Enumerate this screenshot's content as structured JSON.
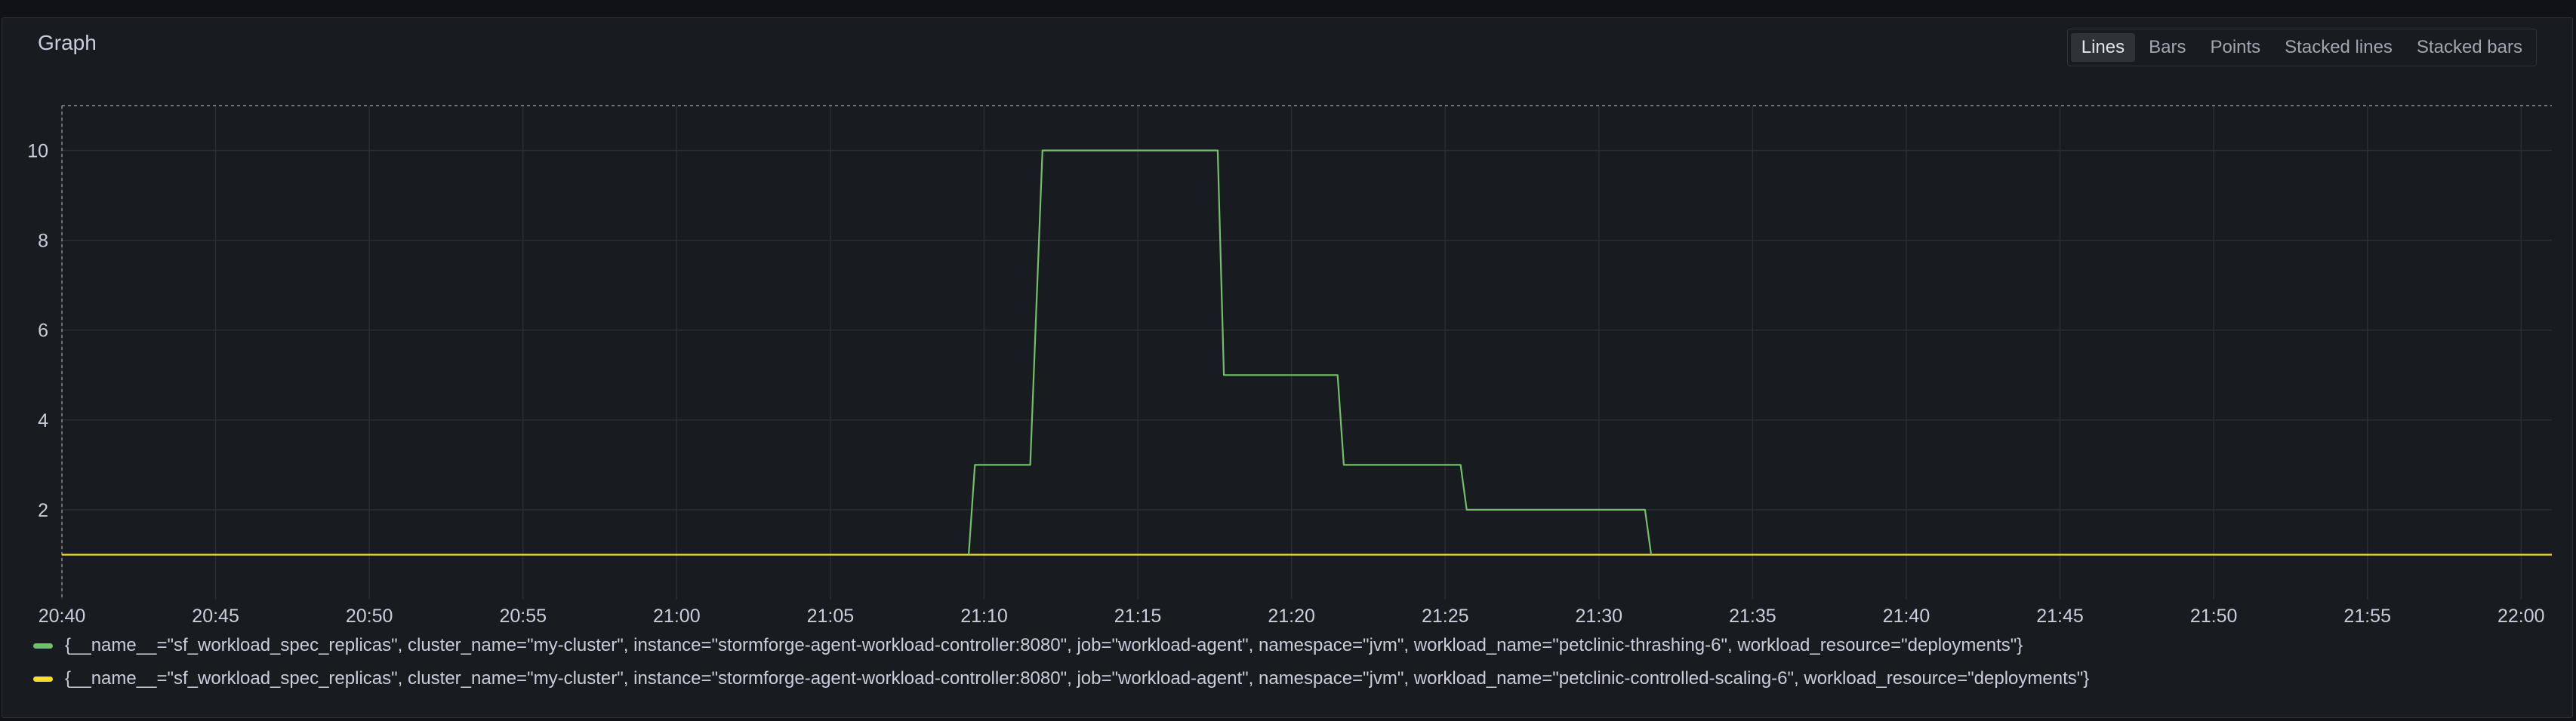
{
  "panel": {
    "title": "Graph"
  },
  "viz_options": [
    {
      "label": "Lines",
      "active": true
    },
    {
      "label": "Bars",
      "active": false
    },
    {
      "label": "Points",
      "active": false
    },
    {
      "label": "Stacked lines",
      "active": false
    },
    {
      "label": "Stacked bars",
      "active": false
    }
  ],
  "chart_data": {
    "type": "line",
    "x_ticks": [
      "20:40",
      "20:45",
      "20:50",
      "20:55",
      "21:00",
      "21:05",
      "21:10",
      "21:15",
      "21:20",
      "21:25",
      "21:30",
      "21:35",
      "21:40",
      "21:45",
      "21:50",
      "21:55",
      "22:00"
    ],
    "y_ticks": [
      2,
      4,
      6,
      8,
      10
    ],
    "xlim": [
      "20:40",
      "22:01"
    ],
    "ylim": [
      0.0,
      11.0
    ],
    "grid": true,
    "legend_position": "bottom",
    "series": [
      {
        "name": "{__name__=\"sf_workload_spec_replicas\", cluster_name=\"my-cluster\", instance=\"stormforge-agent-workload-controller:8080\", job=\"workload-agent\", namespace=\"jvm\", workload_name=\"petclinic-thrashing-6\", workload_resource=\"deployments\"}",
        "color": "#73bf69",
        "points": [
          [
            "21:09.5",
            1
          ],
          [
            "21:09.7",
            3
          ],
          [
            "21:11.5",
            3
          ],
          [
            "21:11.9",
            10
          ],
          [
            "21:17.6",
            10
          ],
          [
            "21:17.8",
            5
          ],
          [
            "21:21.5",
            5
          ],
          [
            "21:21.7",
            3
          ],
          [
            "21:25.5",
            3
          ],
          [
            "21:25.7",
            2
          ],
          [
            "21:31.5",
            2
          ],
          [
            "21:31.7",
            1
          ]
        ]
      },
      {
        "name": "{__name__=\"sf_workload_spec_replicas\", cluster_name=\"my-cluster\", instance=\"stormforge-agent-workload-controller:8080\", job=\"workload-agent\", namespace=\"jvm\", workload_name=\"petclinic-controlled-scaling-6\", workload_resource=\"deployments\"}",
        "color": "#fade2a",
        "points": [
          [
            "20:40",
            1
          ],
          [
            "22:01",
            1
          ]
        ]
      }
    ]
  }
}
